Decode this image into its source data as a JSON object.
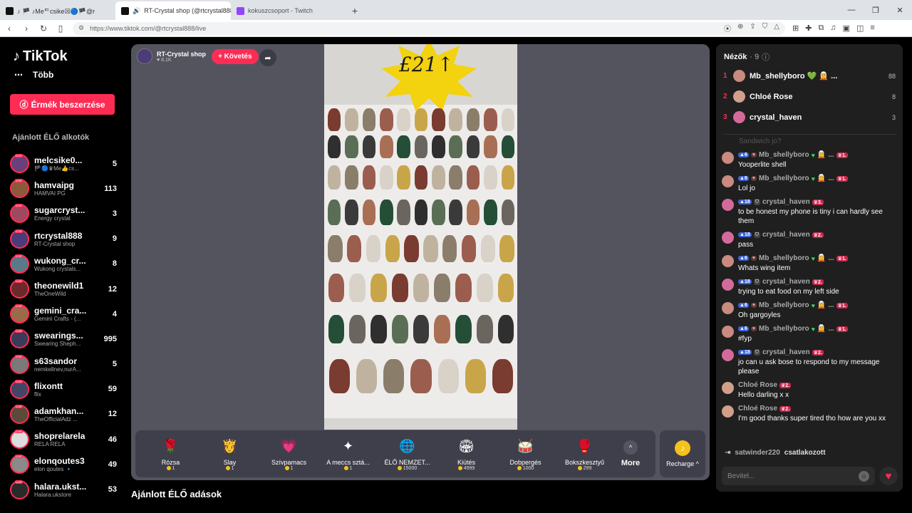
{
  "browser": {
    "tabs": [
      {
        "title": "♪ 🏴 ♪Meᄃcsike☒🔵🏴@r",
        "active": false
      },
      {
        "title": "RT-Crystal shop (@rtcrystal888",
        "active": true
      },
      {
        "title": "kokuszcsoport - Twitch",
        "active": false
      }
    ],
    "url": "https://www.tiktok.com/@rtcrystal888/live"
  },
  "sidebar": {
    "logo": "TikTok",
    "more_label": "Több",
    "coins_button": "Érmék beszerzése",
    "recommended_title": "Ajánlott ÉLŐ alkotók",
    "creators": [
      {
        "name": "melcsike0...",
        "sub": "🏴🔵♛Me👍cs...",
        "count": "5",
        "color": "#6b3f7a"
      },
      {
        "name": "hamvaipg",
        "sub": "HAMVAI PG",
        "count": "113",
        "color": "#8a5a3a"
      },
      {
        "name": "sugarcryst...",
        "sub": "Energy crystal",
        "count": "3",
        "color": "#a04860"
      },
      {
        "name": "rtcrystal888",
        "sub": "RT-Crystal shop",
        "count": "9",
        "color": "#4b3c78"
      },
      {
        "name": "wukong_cr...",
        "sub": "Wukong crystals...",
        "count": "8",
        "color": "#5a7a8a"
      },
      {
        "name": "theonewild1",
        "sub": "TheOneWild",
        "count": "12",
        "color": "#6a2a2a"
      },
      {
        "name": "gemini_cra...",
        "sub": "Gemini Crafts - (...",
        "count": "4",
        "color": "#9a6a4a"
      },
      {
        "name": "swearings...",
        "sub": "Swearing Sheph...",
        "count": "995",
        "color": "#3a3a5a"
      },
      {
        "name": "s63sandor",
        "sub": "nemkellnev,nurA...",
        "count": "5",
        "color": "#7a7a7a"
      },
      {
        "name": "flixontt",
        "sub": "flix",
        "count": "59",
        "color": "#444466"
      },
      {
        "name": "adamkhan...",
        "sub": "TheOfficialAdz ...",
        "count": "12",
        "color": "#5a4a3a"
      },
      {
        "name": "shoprelarela",
        "sub": "RELA RELA",
        "count": "46",
        "color": "#ddd"
      },
      {
        "name": "elonqoutes3",
        "sub": "elon qoutes 🔹",
        "count": "49",
        "color": "#8a8a8a"
      },
      {
        "name": "halara.ukst...",
        "sub": "Halara.ukstore",
        "count": "53",
        "color": "#2a2a2a"
      }
    ]
  },
  "stream": {
    "host_name": "RT-Crystal shop",
    "host_likes": "8.1K",
    "follow_label": "+ Követés",
    "price_sign": "£21↑"
  },
  "gifts": [
    {
      "name": "Rózsa",
      "price": "1",
      "icon": "🌹",
      "bg": "transparent"
    },
    {
      "name": "Slay",
      "price": "1",
      "icon": "👸",
      "bg": "transparent"
    },
    {
      "name": "Szívpamacs",
      "price": "1",
      "icon": "💗",
      "bg": "transparent"
    },
    {
      "name": "A meccs sztá...",
      "price": "1",
      "icon": "✦",
      "bg": "transparent"
    },
    {
      "name": "ÉLŐ NEMZET...",
      "price": "15000",
      "icon": "🌐",
      "bg": "transparent"
    },
    {
      "name": "Kiütés",
      "price": "4999",
      "icon": "🏟",
      "bg": "transparent"
    },
    {
      "name": "Dobpergés",
      "price": "1000",
      "icon": "🥁",
      "bg": "transparent"
    },
    {
      "name": "Bokszkesztyű",
      "price": "299",
      "icon": "🥊",
      "bg": "transparent"
    }
  ],
  "gift_more_label": "More",
  "recharge_label": "Recharge ^",
  "section_title": "Ajánlott ÉLŐ adások",
  "chat": {
    "viewers_label": "Nézők",
    "viewers_count": "· 9",
    "top_viewers": [
      {
        "rank": "1",
        "name": "Mb_shellyboro 💚 🧝 ...",
        "score": "88",
        "color": "#c98a80"
      },
      {
        "rank": "2",
        "name": "Chloé Rose",
        "score": "8",
        "color": "#d2a08a"
      },
      {
        "rank": "3",
        "name": "crystal_haven",
        "score": "3",
        "color": "#d46a9a"
      }
    ],
    "faded_text": "Sandwich jo?",
    "messages": [
      {
        "user": "Mb_shellyboro",
        "level": "6",
        "badge": "1.",
        "text": "Yooperlite shell",
        "color": "#c98a80",
        "fan": true
      },
      {
        "user": "Mb_shellyboro",
        "level": "6",
        "badge": "1.",
        "text": "Lol jo",
        "color": "#c98a80",
        "fan": true
      },
      {
        "user": "crystal_haven",
        "level": "18",
        "badge": "3.",
        "text": "to be honest my phone is tiny i can hardly see them",
        "color": "#d46a9a",
        "fan": false
      },
      {
        "user": "crystal_haven",
        "level": "18",
        "badge": "2.",
        "text": "pass",
        "color": "#d46a9a",
        "fan": false
      },
      {
        "user": "Mb_shellyboro",
        "level": "6",
        "badge": "1.",
        "text": "Whats wing item",
        "color": "#c98a80",
        "fan": true
      },
      {
        "user": "crystal_haven",
        "level": "18",
        "badge": "2.",
        "text": "trying to eat food on my left side",
        "color": "#d46a9a",
        "fan": false
      },
      {
        "user": "Mb_shellyboro",
        "level": "6",
        "badge": "1.",
        "text": "Oh gargoyles",
        "color": "#c98a80",
        "fan": true
      },
      {
        "user": "Mb_shellyboro",
        "level": "6",
        "badge": "1.",
        "text": "#fyp",
        "color": "#c98a80",
        "fan": true
      },
      {
        "user": "crystal_haven",
        "level": "18",
        "badge": "2.",
        "text": "jo can u ask bose to respond to my message please",
        "color": "#d46a9a",
        "fan": false
      },
      {
        "user": "Chloé Rose",
        "level": "",
        "badge": "2.",
        "text": "Hello darling x x",
        "color": "#d2a08a",
        "fan": false
      },
      {
        "user": "Chloé Rose",
        "level": "",
        "badge": "2.",
        "text": "I'm good thanks super tired tho how are you xx",
        "color": "#d2a08a",
        "fan": false
      }
    ],
    "joined_user": "satwinder220",
    "joined_action": "csatlakozott",
    "input_placeholder": "Bevitel..."
  }
}
